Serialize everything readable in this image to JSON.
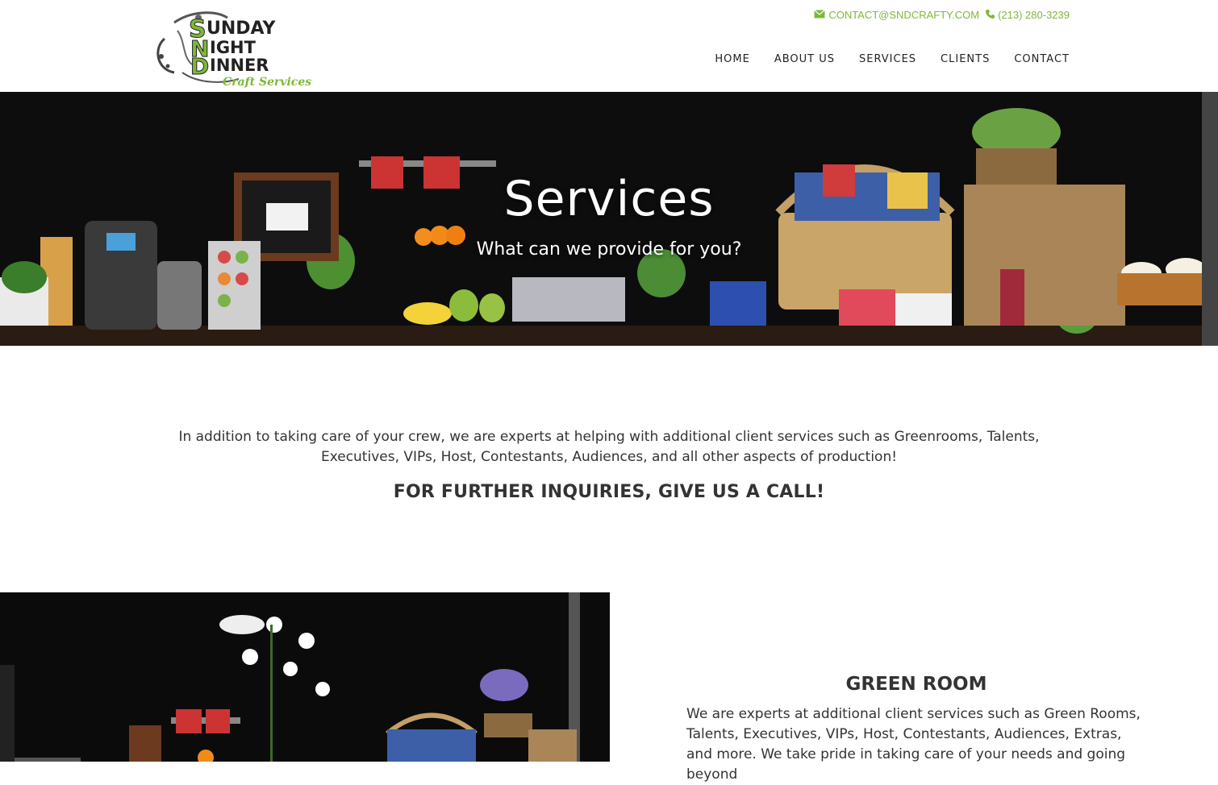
{
  "brand": {
    "logo_line1": "SUNDAY",
    "logo_line2": "NIGHT",
    "logo_line3": "DINNER",
    "logo_tagline": "Craft Services",
    "accent": "#7cb83a"
  },
  "contact": {
    "email": "CONTACT@SNDCRAFTY.COM",
    "email_icon": "envelope-icon",
    "phone": "(213) 280-3239",
    "phone_icon": "phone-icon"
  },
  "nav": {
    "items": [
      {
        "label": "HOME"
      },
      {
        "label": "ABOUT US"
      },
      {
        "label": "SERVICES"
      },
      {
        "label": "CLIENTS"
      },
      {
        "label": "CONTACT"
      }
    ]
  },
  "hero": {
    "title": "Services",
    "subtitle": "What can we provide for you?"
  },
  "intro": {
    "text": "In addition to taking care of your crew, we are experts at helping with additional client services such as Greenrooms, Talents, Executives, VIPs, Host, Contestants, Audiences, and all other aspects of production!",
    "cta": "FOR FURTHER INQUIRIES, GIVE US A CALL!"
  },
  "green_room": {
    "title": "GREEN ROOM",
    "text": "We are experts at additional client services such as Green Rooms, Talents, Executives, VIPs, Host, Contestants, Audiences, Extras, and more. We take pride in taking care of your needs and going beyond"
  }
}
